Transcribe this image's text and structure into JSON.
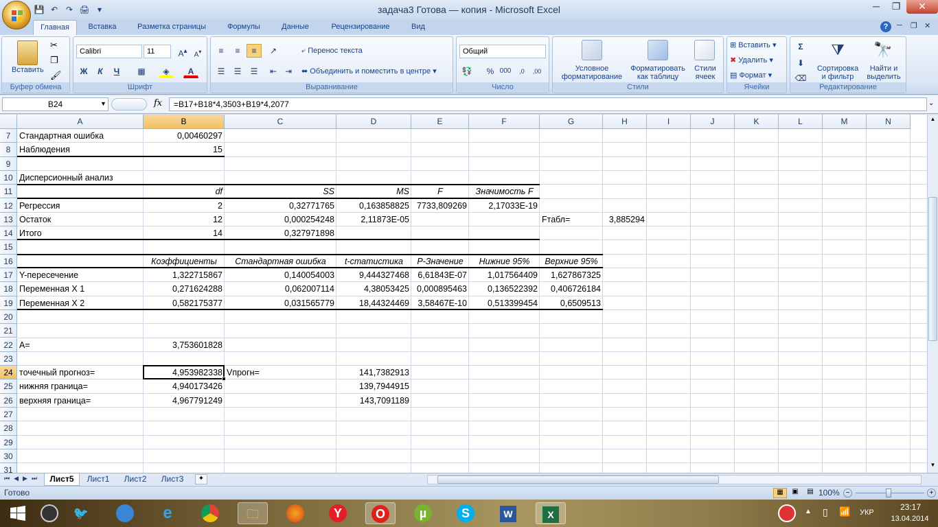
{
  "window": {
    "title": "задача3 Готова — копия - Microsoft Excel"
  },
  "qat": {
    "save": "💾",
    "undo": "↶",
    "redo": "↷",
    "preview": "🖨",
    "more": "▾"
  },
  "win": {
    "min": "─",
    "restore": "❐",
    "close": "✕",
    "help": "?",
    "min2": "─",
    "restore2": "❐",
    "close2": "✕"
  },
  "tabs": [
    "Главная",
    "Вставка",
    "Разметка страницы",
    "Формулы",
    "Данные",
    "Рецензирование",
    "Вид"
  ],
  "ribbon": {
    "clipboard": {
      "label": "Буфер обмена",
      "paste": "Вставить"
    },
    "font": {
      "label": "Шрифт",
      "name": "Calibri",
      "size": "11",
      "bold": "Ж",
      "italic": "К",
      "underline": "Ч"
    },
    "alignment": {
      "label": "Выравнивание",
      "wrap": "Перенос текста",
      "merge": "Объединить и поместить в центре"
    },
    "number": {
      "label": "Число",
      "format": "Общий",
      "percent": "%",
      "thousands": "000"
    },
    "styles": {
      "label": "Стили",
      "conditional": "Условное",
      "conditional2": "форматирование",
      "astable": "Форматировать",
      "astable2": "как таблицу",
      "cellstyles": "Стили",
      "cellstyles2": "ячеек"
    },
    "cells": {
      "label": "Ячейки",
      "insert": "Вставить",
      "delete": "Удалить",
      "format": "Формат"
    },
    "editing": {
      "label": "Редактирование",
      "sort": "Сортировка",
      "sort2": "и фильтр",
      "find": "Найти и",
      "find2": "выделить"
    }
  },
  "formula_bar": {
    "name_box": "B24",
    "fx": "fx",
    "formula": "=B17+B18*4,3503+B19*4,2077"
  },
  "columns": [
    "A",
    "B",
    "C",
    "D",
    "E",
    "F",
    "G",
    "H",
    "I",
    "J",
    "K",
    "L",
    "M",
    "N"
  ],
  "rows": [
    "7",
    "8",
    "9",
    "10",
    "11",
    "12",
    "13",
    "14",
    "15",
    "16",
    "17",
    "18",
    "19",
    "20",
    "21",
    "22",
    "23",
    "24",
    "25",
    "26",
    "27",
    "28",
    "29",
    "30",
    "31"
  ],
  "cells": {
    "A7": "Стандартная ошибка",
    "B7": "0,00460297",
    "A8": "Наблюдения",
    "B8": "15",
    "A10": "Дисперсионный анализ",
    "B11": "df",
    "C11": "SS",
    "D11": "MS",
    "E11": "F",
    "F11": "Значимость F",
    "A12": "Регрессия",
    "B12": "2",
    "C12": "0,32771765",
    "D12": "0,163858825",
    "E12": "7733,809269",
    "F12": "2,17033E-19",
    "A13": "Остаток",
    "B13": "12",
    "C13": "0,000254248",
    "D13": "2,11873E-05",
    "G13": "Fтабл=",
    "H13": "3,885294",
    "A14": "Итого",
    "B14": "14",
    "C14": "0,327971898",
    "B16": "Коэффициенты",
    "C16": "Стандартная ошибка",
    "D16": "t-статистика",
    "E16": "P-Значение",
    "F16": "Нижние 95%",
    "G16": "Верхние 95%",
    "A17": "Y-пересечение",
    "B17": "1,322715867",
    "C17": "0,140054003",
    "D17": "9,444327468",
    "E17": "6,61843E-07",
    "F17": "1,017564409",
    "G17": "1,627867325",
    "A18": "Переменная X 1",
    "B18": "0,271624288",
    "C18": "0,062007114",
    "D18": "4,38053425",
    "E18": "0,000895463",
    "F18": "0,136522392",
    "G18": "0,406726184",
    "A19": "Переменная X 2",
    "B19": "0,582175377",
    "C19": "0,031565779",
    "D19": "18,44324469",
    "E19": "3,58467E-10",
    "F19": "0,513399454",
    "G19": "0,6509513",
    "A22": "A=",
    "B22": "3,753601828",
    "A24": "точечный прогноз=",
    "B24": "4,953982338",
    "C24": "Vпрогн=",
    "D24": "141,7382913",
    "A25": "нижняя граница=",
    "B25": "4,940173426",
    "D25": "139,7944915",
    "A26": "верхняя граница=",
    "B26": "4,967791249",
    "D26": "143,7091189"
  },
  "sheets": [
    "Лист5",
    "Лист1",
    "Лист2",
    "Лист3"
  ],
  "status": {
    "ready": "Готово",
    "zoom": "100%"
  },
  "taskbar": {
    "lang": "УКР",
    "time": "23:17",
    "date": "13.04.2014"
  }
}
